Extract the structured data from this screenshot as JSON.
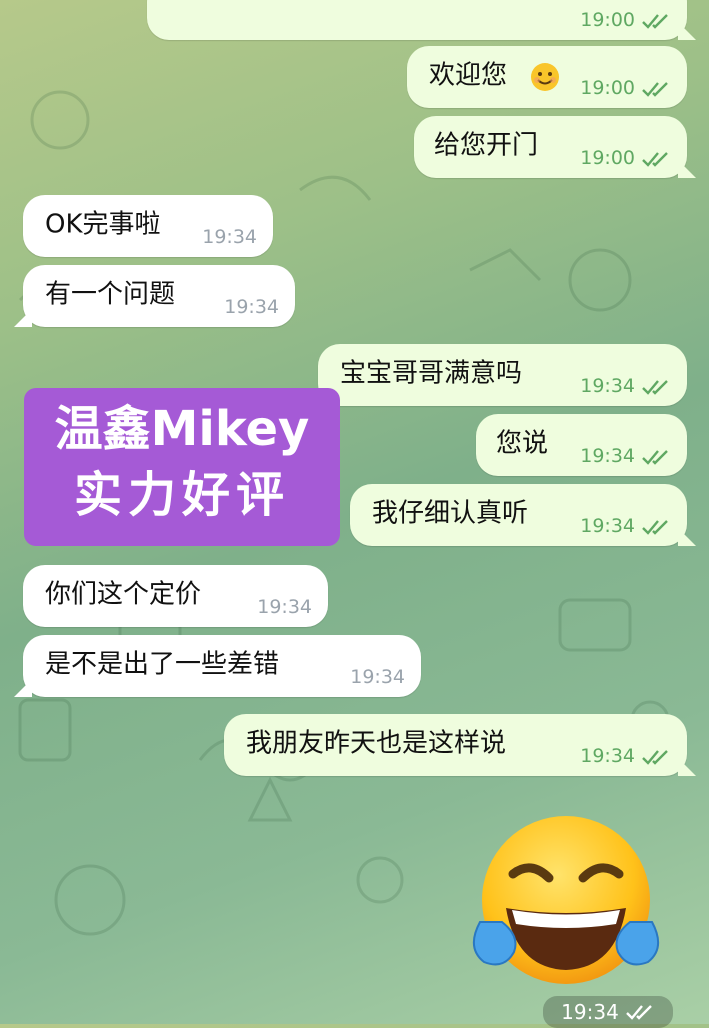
{
  "messages": [
    {
      "id": "m0",
      "dir": "out",
      "text": "",
      "time": "19:00",
      "read": true
    },
    {
      "id": "m1",
      "dir": "out",
      "text": "欢迎您",
      "emoji": "smile-emoji",
      "time": "19:00",
      "read": true
    },
    {
      "id": "m2",
      "dir": "out",
      "text": "给您开门",
      "time": "19:00",
      "read": true
    },
    {
      "id": "m3",
      "dir": "in",
      "text": "OK完事啦",
      "time": "19:34"
    },
    {
      "id": "m4",
      "dir": "in",
      "text": "有一个问题",
      "time": "19:34"
    },
    {
      "id": "m5",
      "dir": "out",
      "text": "宝宝哥哥满意吗",
      "time": "19:34",
      "read": true
    },
    {
      "id": "m6",
      "dir": "out",
      "text": "您说",
      "time": "19:34",
      "read": true
    },
    {
      "id": "m7",
      "dir": "out",
      "text": "我仔细认真听",
      "time": "19:34",
      "read": true
    },
    {
      "id": "m8",
      "dir": "in",
      "text": "你们这个定价",
      "time": "19:34"
    },
    {
      "id": "m9",
      "dir": "in",
      "text": "是不是出了一些差错",
      "time": "19:34"
    },
    {
      "id": "m10",
      "dir": "out",
      "text": "我朋友昨天也是这样说",
      "time": "19:34",
      "read": true
    }
  ],
  "overlay": {
    "line1": "温鑫Mikey",
    "line2": "实力好评"
  },
  "sticker": {
    "icon": "laughing-tears-emoji",
    "time": "19:34",
    "read": true
  },
  "colors": {
    "incoming": "#ffffff",
    "outgoing": "#effdde",
    "outgoing_time": "#5fa862",
    "overlay": "#a55ad6"
  }
}
